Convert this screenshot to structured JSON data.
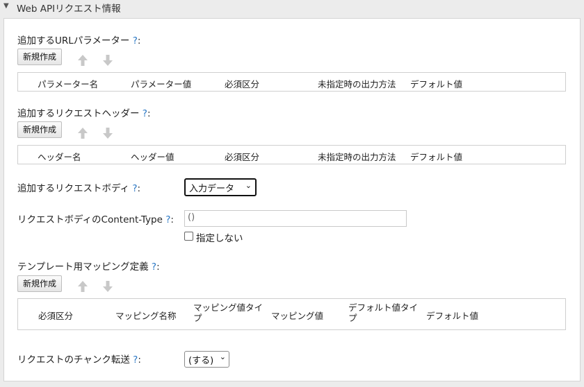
{
  "section": {
    "title": "Web APIリクエスト情報",
    "collapse_glyph": "▼"
  },
  "help_mark": "?",
  "colon": ":",
  "url_params": {
    "label": "追加するURLパラメーター",
    "new_button": "新規作成",
    "columns": [
      "パラメーター名",
      "パラメーター値",
      "必須区分",
      "未指定時の出力方法",
      "デフォルト値"
    ]
  },
  "request_headers": {
    "label": "追加するリクエストヘッダー",
    "new_button": "新規作成",
    "columns": [
      "ヘッダー名",
      "ヘッダー値",
      "必須区分",
      "未指定時の出力方法",
      "デフォルト値"
    ]
  },
  "request_body": {
    "label": "追加するリクエストボディ",
    "selected": "入力データ"
  },
  "content_type": {
    "label": "リクエストボディのContent-Type",
    "value": "()",
    "checkbox_label": "指定しない",
    "checked": false
  },
  "template_mapping": {
    "label": "テンプレート用マッピング定義",
    "new_button": "新規作成",
    "columns": [
      "必須区分",
      "マッピング名称",
      "マッピング値タイプ",
      "マッピング値",
      "デフォルト値タイプ",
      "デフォルト値"
    ]
  },
  "chunked_transfer": {
    "label": "リクエストのチャンク転送",
    "selected": "(する)"
  },
  "colors": {
    "help": "#2b78c5",
    "arrow_disabled": "#c8c8c8",
    "border": "#cfcfcf"
  }
}
